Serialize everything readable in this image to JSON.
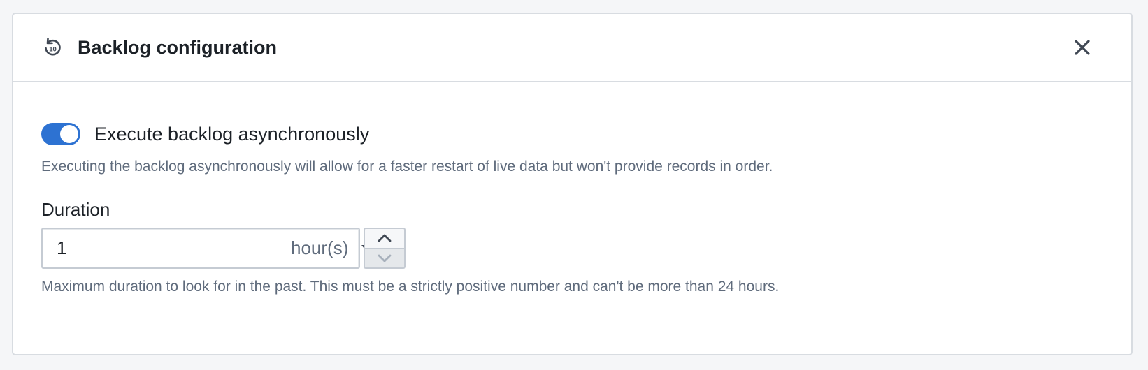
{
  "panel": {
    "title": "Backlog configuration",
    "header_icon": "replay-10-icon",
    "close_icon": "close-icon"
  },
  "async_toggle": {
    "label": "Execute backlog asynchronously",
    "checked": true,
    "accent_color": "#2d72d2",
    "help": "Executing the backlog asynchronously will allow for a faster restart of live data but won't provide records in order."
  },
  "duration": {
    "label": "Duration",
    "value": "1",
    "unit": "hour(s)",
    "unit_icon": "caret-down-icon",
    "increment_icon": "chevron-up-icon",
    "decrement_icon": "chevron-down-icon",
    "help": "Maximum duration to look for in the past. This must be a strictly positive number and can't be more than 24 hours."
  }
}
